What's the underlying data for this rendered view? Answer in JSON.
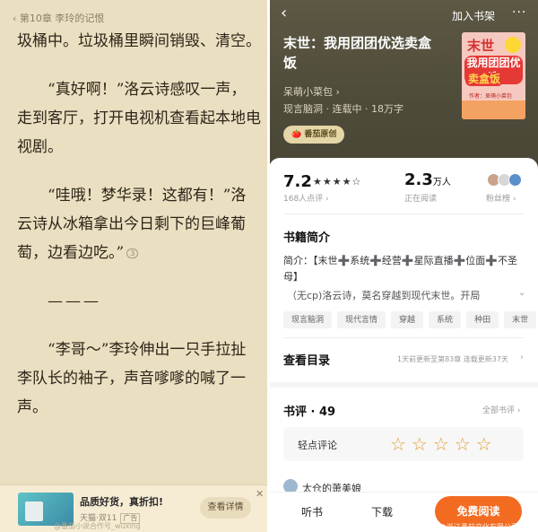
{
  "reader": {
    "chapter_title": "第10章 李玲的记恨",
    "paragraphs": [
      "圾桶中。垃圾桶里瞬间销毁、清空。",
      "“真好啊！”洛云诗感叹一声，走到客厅，打开电视机查看起本地电视剧。",
      "“哇哦！梦华录！这都有！”洛云诗从冰箱拿出今日剩下的巨峰葡萄，边看边吃。”",
      "———",
      "“李哥～”李玲伸出一只手拉扯李队长的袖子，声音嗲嗲的喊了一声。"
    ],
    "comment_count": "3",
    "ad": {
      "title": "品质好货，真折扣!",
      "sub": "天猫·双11",
      "tag": "广告",
      "button": "查看详情",
      "close": "✕"
    },
    "watermark": "@番茄小说合作号_wuxing"
  },
  "detail": {
    "back": "‹",
    "add_shelf": "加入书架",
    "more": "···",
    "title": "末世：我用团团优选卖盒饭",
    "author": "呆萌小菜包 ›",
    "meta": "现言脑洞 · 连载中 · 18万字",
    "badge": "番茄原创",
    "cover": {
      "line1": "末世",
      "line2": "我用团团优选",
      "line3": "卖盒饭",
      "line4": "作者：呆萌小菜包"
    },
    "rating": "7.2",
    "stars": "★★★★☆",
    "rating_sub": "168人点评 ›",
    "readers": "2.3",
    "readers_unit": "万人",
    "readers_sub": "正在阅读",
    "fans": "粉丝榜 ›",
    "intro_title": "书籍简介",
    "intro_line1": "简介：【末世➕系统➕经营➕星际直播➕位面➕不圣母】",
    "intro_line2": "（无cp)洛云诗，莫名穿越到现代末世。开局",
    "tags": [
      "现言脑洞",
      "现代言情",
      "穿越",
      "系统",
      "种田",
      "末世"
    ],
    "toc_title": "查看目录",
    "toc_info": "1天前更新至第83章 连载更新37天",
    "review_title": "书评 · 49",
    "all_reviews": "全部书评 ›",
    "rate_label": "轻点评论",
    "rate_stars": "☆☆☆☆☆",
    "reviewer": "太仓的萧美娘",
    "bottom": {
      "listen": "听书",
      "download": "下载",
      "free_read": "免费阅读"
    },
    "watermark": "@浙江番茄文化有限公司_wuxing"
  },
  "colors": {
    "accent": "#f26b21",
    "reader_bg": "#ebdfc2",
    "hero_bg": "#4f4b3a",
    "star_outline": "#e0a03a"
  }
}
